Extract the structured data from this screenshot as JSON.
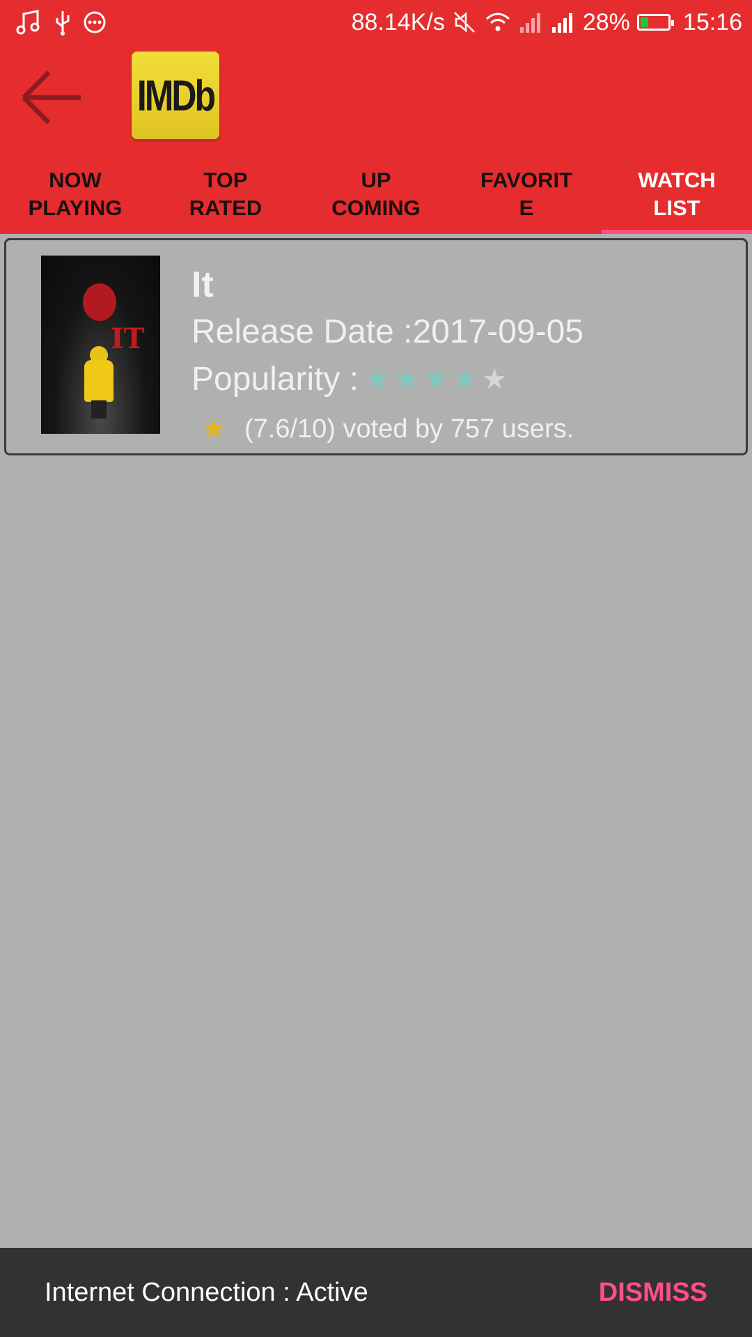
{
  "status_bar": {
    "left_icons": [
      "music-icon",
      "usb-icon",
      "more-icon"
    ],
    "network_speed": "88.14K/s",
    "right_icons": [
      "mute-icon",
      "wifi-icon",
      "signal-weak-icon",
      "signal-icon"
    ],
    "battery_percent": "28%",
    "battery_level": 0.28,
    "time": "15:16"
  },
  "app_bar": {
    "back_icon": "arrow-left-icon",
    "logo_text": "IMDb"
  },
  "tabs": [
    {
      "label": "NOW\nPLAYING",
      "active": false
    },
    {
      "label": "TOP\nRATED",
      "active": false
    },
    {
      "label": "UP\nCOMING",
      "active": false
    },
    {
      "label": "FAVORIT\nE",
      "active": false
    },
    {
      "label": "WATCH\nLIST",
      "active": true
    }
  ],
  "movies": [
    {
      "title": "It",
      "poster_title": "IT",
      "release_date": "Release Date :2017-09-05",
      "popularity_label": "Popularity :",
      "popularity_stars": 4,
      "popularity_max": 5,
      "vote_text": "(7.6/10) voted by 757 users."
    }
  ],
  "snackbar": {
    "message": "Internet Connection : Active",
    "action": "DISMISS"
  },
  "colors": {
    "app_bar": "#e52d2f",
    "background": "#b0b0af",
    "tab_indicator": "#ff4f86",
    "snackbar": "#323232",
    "snackbar_action": "#ff4f86",
    "star_filled": "#80c8c0",
    "star_empty": "#d6d6d6",
    "vote_star": "#e3b51f"
  }
}
